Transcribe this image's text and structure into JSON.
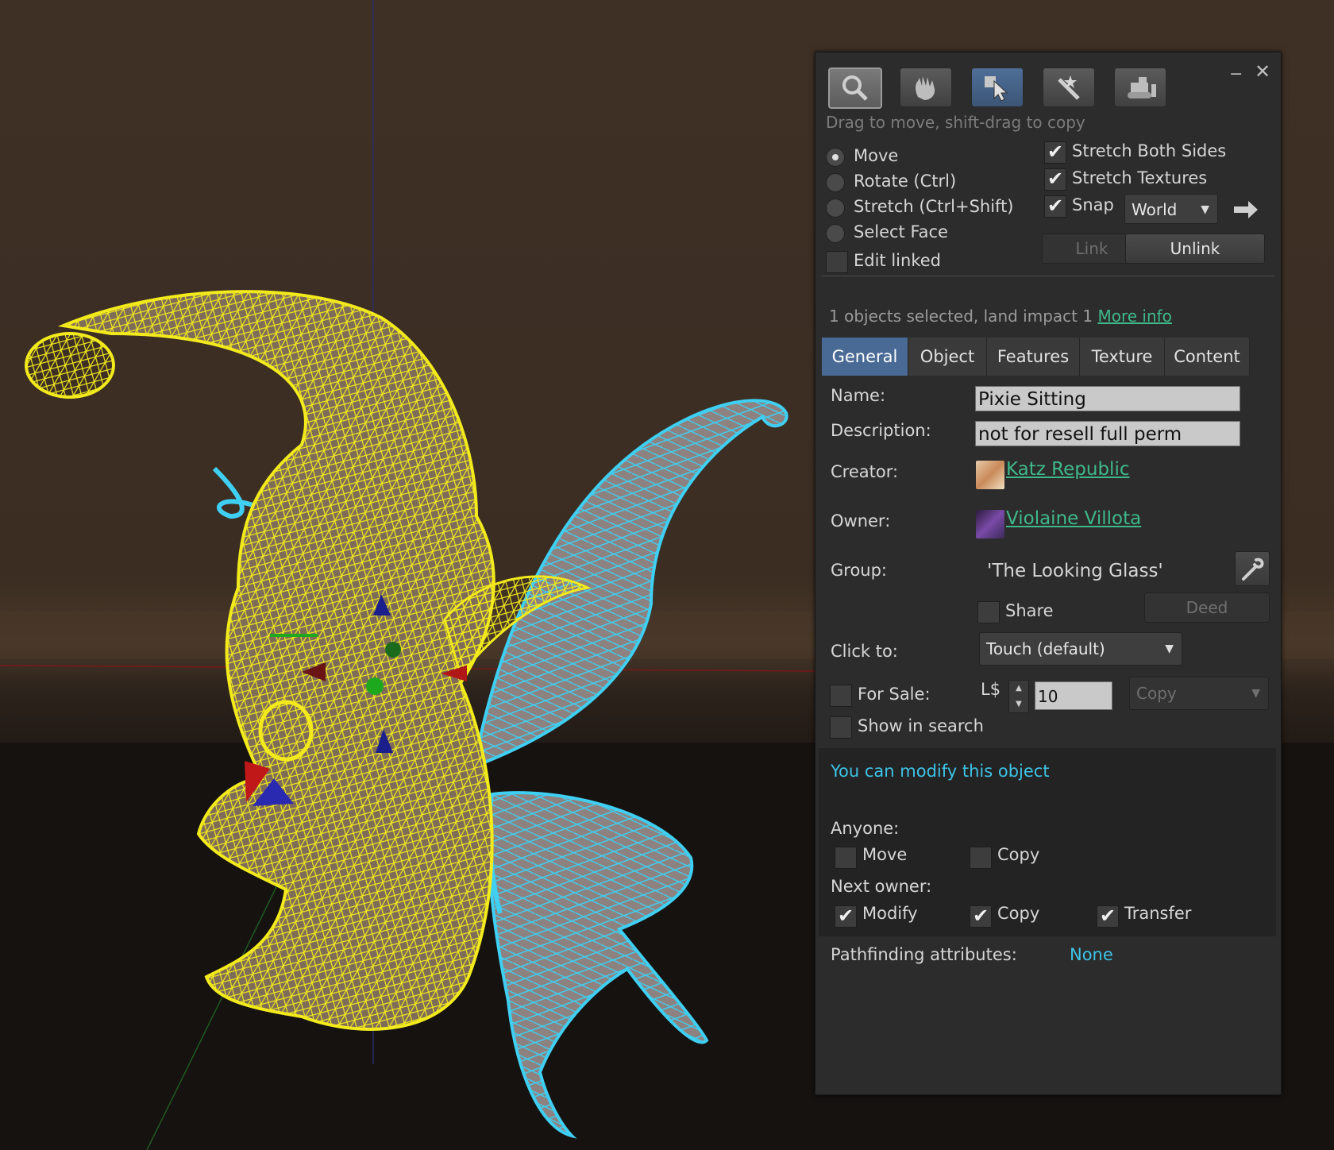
{
  "window": {
    "minimize_label": "‒",
    "close_label": "✕"
  },
  "toolbar": {
    "tools": [
      {
        "name": "focus",
        "icon": "magnifier-icon"
      },
      {
        "name": "grab",
        "icon": "hand-icon"
      },
      {
        "name": "edit",
        "icon": "arrow-cursor-icon"
      },
      {
        "name": "create",
        "icon": "magic-wand-icon"
      },
      {
        "name": "land",
        "icon": "bulldozer-icon"
      }
    ],
    "hint": "Drag to move, shift-drag to copy"
  },
  "modes": {
    "move": "Move",
    "rotate": "Rotate (Ctrl)",
    "stretch": "Stretch (Ctrl+Shift)",
    "select_face": "Select Face",
    "edit_linked": "Edit linked"
  },
  "options": {
    "stretch_both_sides": "Stretch Both Sides",
    "stretch_textures": "Stretch Textures",
    "snap": "Snap",
    "snap_mode": "World",
    "link": "Link",
    "unlink": "Unlink"
  },
  "selection": {
    "summary": "1 objects selected, land impact 1",
    "more_info": "More info"
  },
  "tabs": [
    "General",
    "Object",
    "Features",
    "Texture",
    "Content"
  ],
  "general": {
    "name_label": "Name:",
    "name_value": "Pixie Sitting",
    "description_label": "Description:",
    "description_value": "not for resell full perm",
    "creator_label": "Creator:",
    "creator_value": "Katz Republic",
    "owner_label": "Owner:",
    "owner_value": "Violaine Villota",
    "group_label": "Group:",
    "group_value": "'The Looking Glass'",
    "share_label": "Share",
    "deed_label": "Deed",
    "click_to_label": "Click to:",
    "click_to_value": "Touch  (default)",
    "for_sale_label": "For Sale:",
    "currency": "L$",
    "price": "10",
    "sale_type": "Copy",
    "show_in_search_label": "Show in search"
  },
  "permissions": {
    "status": "You can modify this object",
    "anyone_label": "Anyone:",
    "anyone_move": "Move",
    "anyone_copy": "Copy",
    "next_owner_label": "Next owner:",
    "next_modify": "Modify",
    "next_copy": "Copy",
    "next_transfer": "Transfer",
    "pathfinding_label": "Pathfinding attributes:",
    "pathfinding_value": "None"
  },
  "checkmark": "✔",
  "colors": {
    "panel_bg": "#2c2c2c",
    "active_tab": "#4a6a96",
    "link_green": "#3fb88a",
    "info_cyan": "#3ec3e6",
    "wireframe_yellow": "#f2ea1c",
    "wireframe_cyan": "#3fcff2"
  }
}
